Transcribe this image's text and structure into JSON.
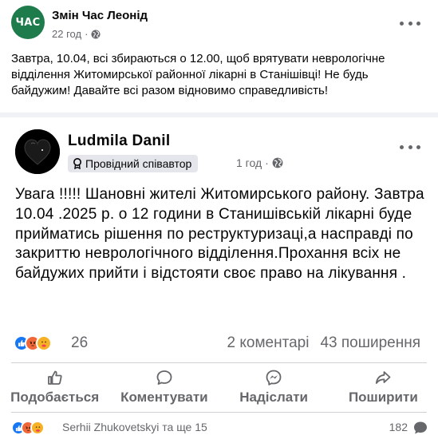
{
  "post1": {
    "avatar_text": "ЧАС",
    "author": "Змін Час Леонід",
    "time": "22 год",
    "separator": "·",
    "text": "Завтра, 10.04, всі збираються о 12.00, щоб врятувати неврологічне відділення Житомирської районної лікарні в Станішівці! Не будь байдужим! Давайте всі разом відновимо справедливість!"
  },
  "post2": {
    "author": "Ludmila Danil",
    "badge": "Провідний співавтор",
    "time": "1 год",
    "separator": "·",
    "text": "Увага !!!!! Шановні жителі Житомирського району. Завтра 10.04 .2025 р. о 12 години в Станишівській лікарні буде прийматись рішення по реструктуризаці,а насправді по закриттю неврологічного відділення.Прохання всіх не байдужих прийти і відстояти своє право на лікування .",
    "reaction_count": "26",
    "comments": "2 коментарі",
    "shares": "43 поширення",
    "actions": {
      "like": "Подобається",
      "comment": "Коментувати",
      "send": "Надіслати",
      "share": "Поширити"
    }
  },
  "footer": {
    "people": "Serhii Zhukovetskyi та ще 15",
    "count": "182"
  },
  "colors": {
    "like_blue": "#1877f2",
    "angry_orange": "#f0683a",
    "care_yellow": "#f7b125",
    "avatar_green": "#1e7b4c",
    "secondary_text": "#65676b"
  },
  "icons": {
    "reactions": [
      "like-icon",
      "angry-icon",
      "care-icon"
    ],
    "actions": [
      "thumbs-up-icon",
      "speech-bubble-icon",
      "messenger-icon",
      "share-arrow-icon"
    ],
    "meta": [
      "globe-icon",
      "more-options-icon",
      "contributor-badge-icon"
    ]
  }
}
